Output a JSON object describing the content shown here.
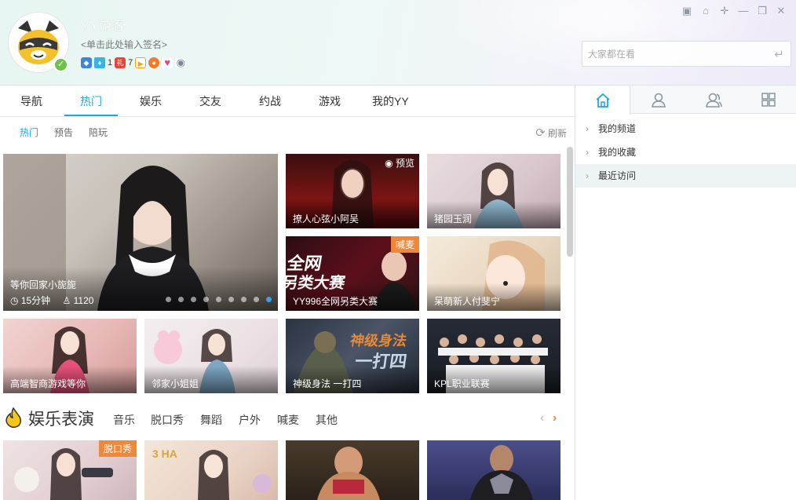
{
  "header": {
    "username": "YY游客",
    "signature": "<单击此处输入签名>",
    "badges": [
      {
        "icon": "gamepad-icon",
        "color": "#3f86d6",
        "count": ""
      },
      {
        "icon": "diamond-icon",
        "color": "#38b3e8",
        "count": "1"
      },
      {
        "icon": "gift-level-icon",
        "color": "#e2473a",
        "count": "7"
      },
      {
        "icon": "video-icon",
        "color": "#f2a216",
        "count": ""
      },
      {
        "icon": "game-controller-icon",
        "color": "#f07b2c",
        "count": ""
      },
      {
        "icon": "heart-icon",
        "color": "#e2457a",
        "count": ""
      },
      {
        "icon": "eye-circle-icon",
        "color": "#7a8896",
        "count": ""
      }
    ],
    "search_placeholder": "大家都在看"
  },
  "nav": {
    "tabs": [
      "导航",
      "热门",
      "娱乐",
      "交友",
      "约战",
      "游戏",
      "我的YY"
    ],
    "active": "热门"
  },
  "subnav": {
    "tabs": [
      "热门",
      "预告",
      "陪玩"
    ],
    "refresh": "刷新"
  },
  "featured": {
    "title": "等你回家小旎旎",
    "duration": "15分钟",
    "viewers": "1120",
    "carousel_count": 9,
    "carousel_active": 9
  },
  "cards": [
    {
      "title": "撩人心弦小阿吴",
      "preview": "预览",
      "tag": ""
    },
    {
      "title": "猪园玉润",
      "preview": "",
      "tag": ""
    },
    {
      "title": "YY996全网另类大赛",
      "preview": "",
      "tag": "喊麦"
    },
    {
      "title": "呆萌新人付斐宁",
      "preview": "",
      "tag": ""
    },
    {
      "title": "高端智商游戏等你",
      "preview": "",
      "tag": ""
    },
    {
      "title": "邻家小姐姐",
      "preview": "",
      "tag": ""
    },
    {
      "title": "神级身法 一打四",
      "preview": "",
      "tag": ""
    },
    {
      "title": "KPL职业联赛",
      "preview": "",
      "tag": ""
    }
  ],
  "section": {
    "title": "娱乐表演",
    "tabs": [
      "音乐",
      "脱口秀",
      "舞蹈",
      "户外",
      "喊麦",
      "其他"
    ]
  },
  "bottom_cards": [
    {
      "tag": "脱口秀"
    },
    {
      "tag": ""
    },
    {
      "tag": ""
    },
    {
      "tag": ""
    }
  ],
  "sidebar": {
    "tabs": [
      "home-icon",
      "contact-icon",
      "group-icon",
      "apps-icon"
    ],
    "items": [
      "我的频道",
      "我的收藏",
      "最近访问"
    ]
  }
}
